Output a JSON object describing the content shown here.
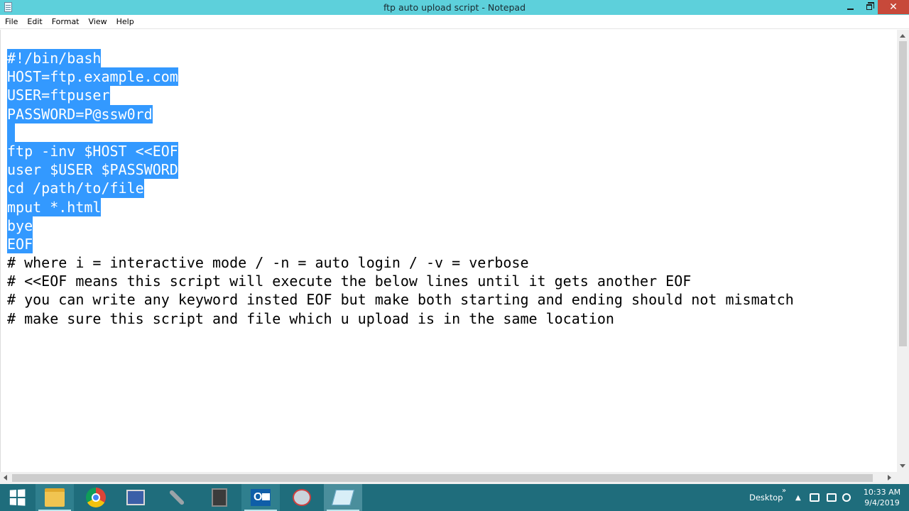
{
  "window": {
    "title": "ftp auto upload script - Notepad",
    "close_glyph": "✕"
  },
  "menu": [
    "File",
    "Edit",
    "Format",
    "View",
    "Help"
  ],
  "editor": {
    "selection_color": "#3399ff",
    "lines": [
      {
        "text": "#!/bin/bash",
        "selected": true
      },
      {
        "text": "HOST=ftp.example.com",
        "selected": true
      },
      {
        "text": "USER=ftpuser",
        "selected": true
      },
      {
        "text": "PASSWORD=P@ssw0rd",
        "selected": true
      },
      {
        "text": "",
        "selected": true
      },
      {
        "text": "ftp -inv $HOST <<EOF",
        "selected": true
      },
      {
        "text": "user $USER $PASSWORD",
        "selected": true
      },
      {
        "text": "cd /path/to/file",
        "selected": true
      },
      {
        "text": "mput *.html",
        "selected": true
      },
      {
        "text": "bye",
        "selected": true
      },
      {
        "text": "EOF",
        "selected": true
      },
      {
        "text": "# where i = interactive mode / -n = auto login / -v = verbose",
        "selected": false
      },
      {
        "text": "# <<EOF means this script will execute the below lines until it gets another EOF",
        "selected": false
      },
      {
        "text": "# you can write any keyword insted EOF but make both starting and ending should not mismatch",
        "selected": false
      },
      {
        "text": "# make sure this script and file which u upload is in the same location",
        "selected": false
      }
    ]
  },
  "taskbar": {
    "apps": [
      {
        "name": "file-explorer-icon",
        "state": "open"
      },
      {
        "name": "chrome-icon",
        "state": "none"
      },
      {
        "name": "network-icon",
        "state": "none"
      },
      {
        "name": "tool-icon",
        "state": "none"
      },
      {
        "name": "putty-icon",
        "state": "none"
      },
      {
        "name": "outlook-icon",
        "state": "open"
      },
      {
        "name": "snipping-tool-icon",
        "state": "none"
      },
      {
        "name": "notepad-icon",
        "state": "active"
      }
    ],
    "outlook_letter": "O",
    "desktop_label": "Desktop",
    "desktop_chevron": "»",
    "tray_up": "▲",
    "time": "10:33 AM",
    "date": "9/4/2019"
  }
}
